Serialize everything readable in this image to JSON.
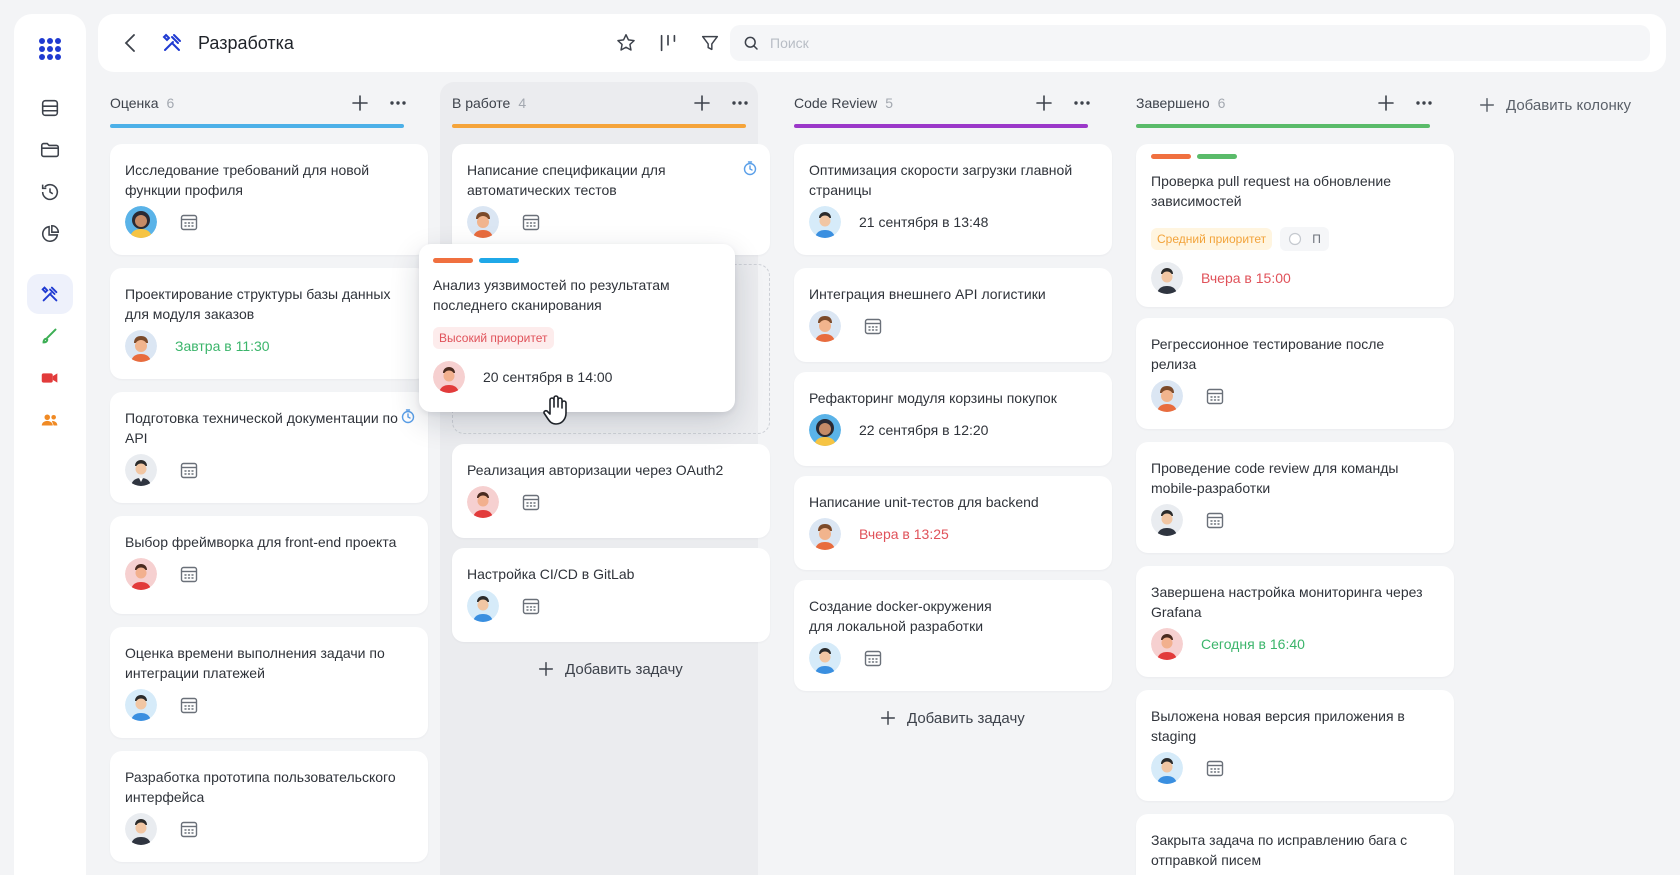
{
  "header": {
    "title": "Разработка",
    "search_placeholder": "Поиск"
  },
  "colors": {
    "accent": "#1f3ad1",
    "estimate": "#4cb0e8",
    "working": "#f5a43a",
    "review": "#9b38c9",
    "done": "#5abb6a",
    "green_text": "#3bb56b",
    "red_text": "#e0525a"
  },
  "columns": [
    {
      "name": "Оценка",
      "count": "6",
      "cards": [
        {
          "title": "Исследование требований для новой функции профиля",
          "avatar": "woman-avatar"
        },
        {
          "title": "Проектирование структуры базы данных для модуля заказов",
          "date": "Завтра в 11:30",
          "date_color": "green"
        },
        {
          "title": "Подготовка технической документации по API",
          "timer": true
        },
        {
          "title": "Выбор фреймворка для front-end проекта"
        },
        {
          "title": "Оценка времени выполнения задачи по интеграции платежей"
        },
        {
          "title": "Разработка прототипа пользовательского интерфейса"
        }
      ]
    },
    {
      "name": "В работе",
      "count": "4",
      "cards": [
        {
          "title": "Написание спецификации для автоматических тестов",
          "timer": true
        },
        {
          "title": "Реализация авторизации через OAuth2"
        },
        {
          "title": "Настройка CI/CD в GitLab"
        }
      ],
      "dragging": {
        "title": "Анализ уязвимостей по результатам последнего сканирования",
        "badge": "Высокий приоритет",
        "date": "20 сентября в 14:00"
      },
      "add_task": "Добавить задачу"
    },
    {
      "name": "Code Review",
      "count": "5",
      "cards": [
        {
          "title": "Оптимизация скорости загрузки главной страницы",
          "date": "21 сентября в 13:48"
        },
        {
          "title": "Интеграция внешнего API логистики"
        },
        {
          "title": "Рефакторинг модуля корзины покупок",
          "date": "22 сентября в 12:20"
        },
        {
          "title": "Написание unit-тестов для backend",
          "date": "Вчера в 13:25",
          "date_color": "red"
        },
        {
          "title": "Создание docker-окружения для локальной разработки"
        }
      ],
      "add_task": "Добавить задачу"
    },
    {
      "name": "Завершено",
      "count": "6",
      "cards": [
        {
          "title": "Проверка pull request на обновление зависимостей",
          "badge": "Средний приоритет",
          "toggle_label": "П",
          "date": "Вчера в 15:00",
          "date_color": "red"
        },
        {
          "title": "Регрессионное тестирование после релиза"
        },
        {
          "title": "Проведение code review для команды mobile-разработки"
        },
        {
          "title": "Завершена настройка мониторинга через Grafana",
          "date": "Сегодня в 16:40",
          "date_color": "green"
        },
        {
          "title": "Выложена новая версия приложения в staging"
        },
        {
          "title": "Закрыта задача по исправлению бага с отправкой писем"
        }
      ]
    }
  ],
  "add_column": "Добавить колонку"
}
